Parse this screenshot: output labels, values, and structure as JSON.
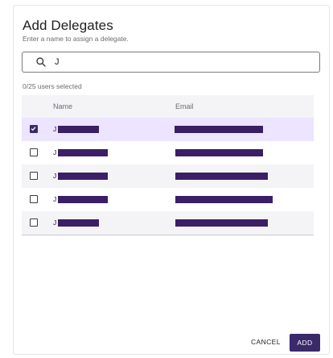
{
  "dialog": {
    "title": "Add Delegates",
    "subtitle": "Enter a name to assign a delegate."
  },
  "search": {
    "value": "J",
    "icon": "search-icon"
  },
  "selection": {
    "count_text": "0/25 users selected"
  },
  "table": {
    "headers": {
      "name": "Name",
      "email": "Email"
    },
    "rows": [
      {
        "name_initial": "J",
        "checked": true,
        "redacted": true
      },
      {
        "name_initial": "J",
        "checked": false,
        "redacted": true
      },
      {
        "name_initial": "J",
        "checked": false,
        "redacted": true
      },
      {
        "name_initial": "J",
        "checked": false,
        "redacted": true
      },
      {
        "name_initial": "J",
        "checked": false,
        "redacted": true
      }
    ]
  },
  "actions": {
    "cancel_label": "CANCEL",
    "add_label": "ADD"
  },
  "colors": {
    "accent": "#3a2a6a",
    "selected_row": "#ede4ff",
    "redaction": "#3b1f66"
  }
}
